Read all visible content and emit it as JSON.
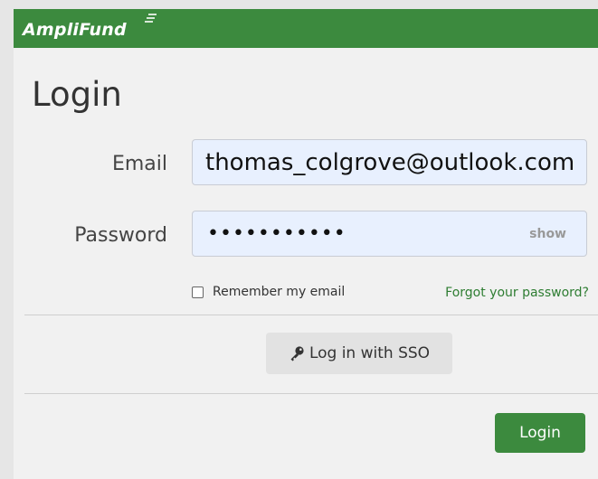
{
  "header": {
    "logo_text": "AmpliFund",
    "brand_color": "#3c8a3e"
  },
  "page": {
    "title": "Login"
  },
  "form": {
    "email_label": "Email",
    "email_value": "thomas_colgrove@outlook.com",
    "password_label": "Password",
    "password_masked": "•••••••••••",
    "show_label": "show",
    "remember_label": "Remember my email",
    "remember_checked": false,
    "forgot_label": "Forgot your password?"
  },
  "actions": {
    "sso_label": "Log in with SSO",
    "sso_icon": "key-icon",
    "login_label": "Login"
  }
}
